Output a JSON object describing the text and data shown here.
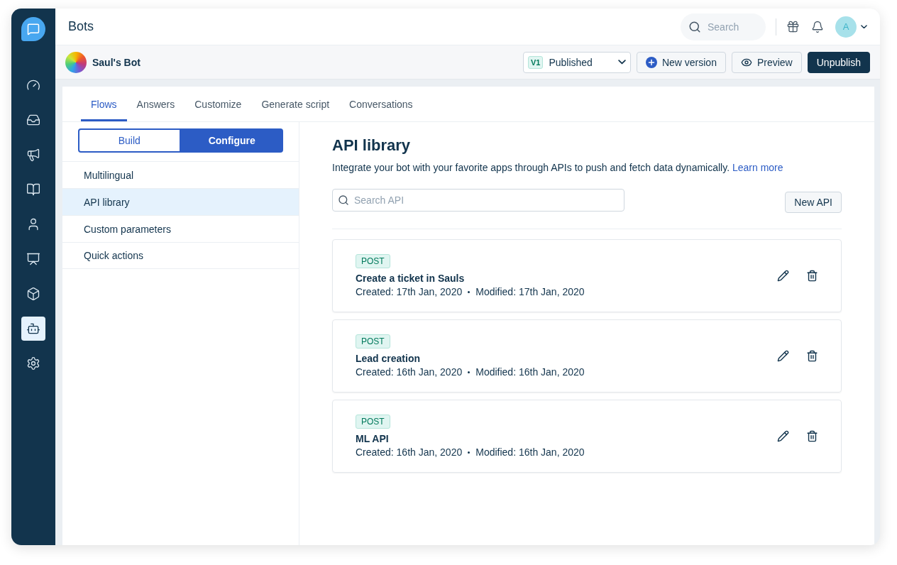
{
  "header": {
    "title": "Bots",
    "search": {
      "placeholder": "Search"
    },
    "avatar": "A"
  },
  "nav": [
    {
      "kind": "dashboard",
      "selected": false
    },
    {
      "kind": "inbox",
      "selected": false
    },
    {
      "kind": "campaigns",
      "selected": false
    },
    {
      "kind": "knowledge",
      "selected": false
    },
    {
      "kind": "contacts",
      "selected": false
    },
    {
      "kind": "reports",
      "selected": false
    },
    {
      "kind": "apps",
      "selected": false
    },
    {
      "kind": "bots",
      "selected": true
    },
    {
      "kind": "settings",
      "selected": false
    }
  ],
  "bot": {
    "name": "Saul's Bot",
    "version": {
      "badge": "V1",
      "status": "Published"
    },
    "buttons": [
      {
        "kind": "new",
        "label": "New version"
      },
      {
        "kind": "preview",
        "label": "Preview"
      },
      {
        "kind": "primary",
        "label": "Unpublish"
      }
    ]
  },
  "tabs": [
    {
      "label": "Flows",
      "selected": true
    },
    {
      "label": "Answers",
      "selected": false
    },
    {
      "label": "Customize",
      "selected": false
    },
    {
      "label": "Generate script",
      "selected": false
    },
    {
      "label": "Conversations",
      "selected": false
    }
  ],
  "mode_toggle": [
    {
      "label": "Build",
      "selected": false
    },
    {
      "label": "Configure",
      "selected": true
    }
  ],
  "menu": [
    {
      "label": "Multilingual",
      "selected": false
    },
    {
      "label": "API library",
      "selected": true
    },
    {
      "label": "Custom parameters",
      "selected": false
    },
    {
      "label": "Quick actions",
      "selected": false
    }
  ],
  "page": {
    "title": "API library",
    "description": "Integrate your bot with your favorite apps through APIs to push and fetch data dynamically.",
    "link": "Learn more",
    "search": {
      "placeholder": "Search API"
    },
    "new_button": "New API"
  },
  "apis": [
    {
      "method": "POST",
      "name": "Create a ticket in Sauls",
      "created": "Created: 17th Jan, 2020",
      "modified": "Modified: 17th Jan, 2020"
    },
    {
      "method": "POST",
      "name": "Lead creation",
      "created": "Created: 16th Jan, 2020",
      "modified": "Modified: 16th Jan, 2020"
    },
    {
      "method": "POST",
      "name": "ML API",
      "created": "Created: 16th Jan, 2020",
      "modified": "Modified: 16th Jan, 2020"
    }
  ]
}
